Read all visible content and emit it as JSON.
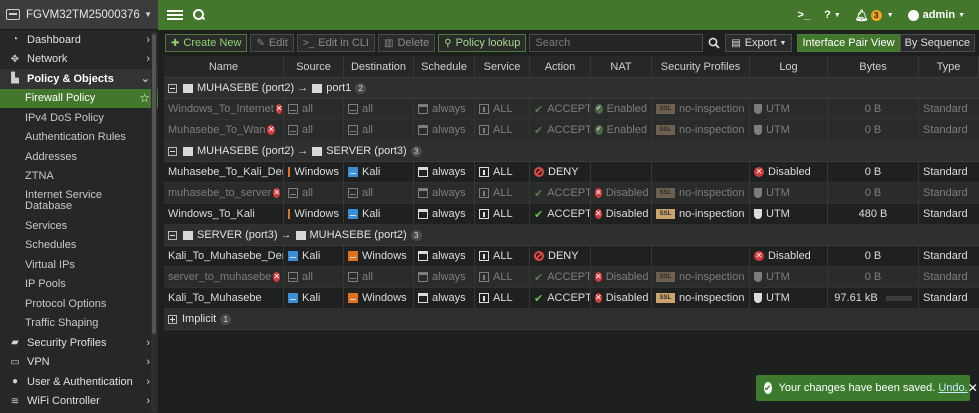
{
  "device": {
    "name": "FGVM32TM25000376"
  },
  "topbar": {
    "cli_icon": ">_",
    "help_icon": "?",
    "alert_count": "3",
    "user": "admin"
  },
  "sidebar": {
    "items": [
      {
        "label": "Dashboard",
        "icon": "dashboard-icon",
        "glyph": "◔"
      },
      {
        "label": "Network",
        "icon": "network-icon",
        "glyph": "✥"
      },
      {
        "label": "Policy & Objects",
        "icon": "policy-objects-icon",
        "glyph": "▙"
      }
    ],
    "sub_items": [
      {
        "label": "Firewall Policy"
      },
      {
        "label": "IPv4 DoS Policy"
      },
      {
        "label": "Authentication Rules"
      },
      {
        "label": "Addresses"
      },
      {
        "label": "ZTNA"
      },
      {
        "label": "Internet Service Database"
      },
      {
        "label": "Services"
      },
      {
        "label": "Schedules"
      },
      {
        "label": "Virtual IPs"
      },
      {
        "label": "IP Pools"
      },
      {
        "label": "Protocol Options"
      },
      {
        "label": "Traffic Shaping"
      }
    ],
    "bottom_items": [
      {
        "label": "Security Profiles",
        "icon": "lock-icon",
        "glyph": "▰"
      },
      {
        "label": "VPN",
        "icon": "monitor-icon",
        "glyph": "▭"
      },
      {
        "label": "User & Authentication",
        "icon": "user-icon",
        "glyph": "●"
      },
      {
        "label": "WiFi Controller",
        "icon": "wifi-icon",
        "glyph": "≋"
      }
    ]
  },
  "toolbar": {
    "create_new": "Create New",
    "edit": "Edit",
    "edit_cli": "Edit in CLI",
    "delete": "Delete",
    "policy_lookup": "Policy lookup",
    "search_placeholder": "Search",
    "export": "Export",
    "interface_pair_view": "Interface Pair View",
    "by_sequence": "By Sequence"
  },
  "table": {
    "columns": [
      "Name",
      "Source",
      "Destination",
      "Schedule",
      "Service",
      "Action",
      "NAT",
      "Security Profiles",
      "Log",
      "Bytes",
      "Type"
    ],
    "groups": [
      {
        "src": "MUHASEBE (port2)",
        "dst": "port1",
        "count": "2",
        "rows": [
          {
            "name": "Windows_To_Internet",
            "disabled": true,
            "source": "all",
            "src_type": "plain",
            "destination": "all",
            "dst_type": "plain",
            "schedule": "always",
            "service": "ALL",
            "action": "ACCEPT",
            "nat": "Enabled",
            "profile_ssl": "SSL",
            "profile": "no-inspection",
            "log": "UTM",
            "bytes": "0 B",
            "bar": false,
            "type": "Standard"
          },
          {
            "name": "Muhasebe_To_Wan",
            "disabled": true,
            "source": "all",
            "src_type": "plain",
            "destination": "all",
            "dst_type": "plain",
            "schedule": "always",
            "service": "ALL",
            "action": "ACCEPT",
            "nat": "Enabled",
            "profile_ssl": "SSL",
            "profile": "no-inspection",
            "log": "UTM",
            "bytes": "0 B",
            "bar": false,
            "type": "Standard"
          }
        ]
      },
      {
        "src": "MUHASEBE (port2)",
        "dst": "SERVER (port3)",
        "count": "3",
        "rows": [
          {
            "name": "Muhasebe_To_Kali_Deny",
            "disabled": false,
            "source": "Windows",
            "src_type": "orange",
            "destination": "Kali",
            "dst_type": "blue",
            "schedule": "always",
            "service": "ALL",
            "action": "DENY",
            "nat": "",
            "profile_ssl": "",
            "profile": "",
            "log": "Disabled",
            "bytes": "0 B",
            "bar": false,
            "type": "Standard"
          },
          {
            "name": "muhasebe_to_server",
            "disabled": true,
            "source": "all",
            "src_type": "plain",
            "destination": "all",
            "dst_type": "plain",
            "schedule": "always",
            "service": "ALL",
            "action": "ACCEPT",
            "nat": "Disabled",
            "profile_ssl": "SSL",
            "profile": "no-inspection",
            "log": "UTM",
            "bytes": "0 B",
            "bar": false,
            "type": "Standard"
          },
          {
            "name": "Windows_To_Kali",
            "disabled": false,
            "source": "Windows",
            "src_type": "orange",
            "destination": "Kali",
            "dst_type": "blue",
            "schedule": "always",
            "service": "ALL",
            "action": "ACCEPT",
            "nat": "Disabled",
            "profile_ssl": "SSL",
            "profile": "no-inspection",
            "log": "UTM",
            "bytes": "480 B",
            "bar": false,
            "type": "Standard"
          }
        ]
      },
      {
        "src": "SERVER (port3)",
        "dst": "MUHASEBE (port2)",
        "count": "3",
        "rows": [
          {
            "name": "Kali_To_Muhasebe_Deny",
            "disabled": false,
            "source": "Kali",
            "src_type": "blue",
            "destination": "Windows",
            "dst_type": "orange",
            "schedule": "always",
            "service": "ALL",
            "action": "DENY",
            "nat": "",
            "profile_ssl": "",
            "profile": "",
            "log": "Disabled",
            "bytes": "0 B",
            "bar": false,
            "type": "Standard"
          },
          {
            "name": "server_to_muhasebe",
            "disabled": true,
            "source": "all",
            "src_type": "plain",
            "destination": "all",
            "dst_type": "plain",
            "schedule": "always",
            "service": "ALL",
            "action": "ACCEPT",
            "nat": "Disabled",
            "profile_ssl": "SSL",
            "profile": "no-inspection",
            "log": "UTM",
            "bytes": "0 B",
            "bar": false,
            "type": "Standard"
          },
          {
            "name": "Kali_To_Muhasebe",
            "disabled": false,
            "source": "Kali",
            "src_type": "blue",
            "destination": "Windows",
            "dst_type": "orange",
            "schedule": "always",
            "service": "ALL",
            "action": "ACCEPT",
            "nat": "Disabled",
            "profile_ssl": "SSL",
            "profile": "no-inspection",
            "log": "UTM",
            "bytes": "97.61 kB",
            "bar": true,
            "type": "Standard"
          }
        ]
      }
    ],
    "implicit": {
      "label": "Implicit",
      "count": "1"
    }
  },
  "toast": {
    "message": "Your changes have been saved.",
    "undo": "Undo.",
    "close": "✕"
  },
  "colors": {
    "accent": "#43772c",
    "deny": "#e04848",
    "disabled_log": "#d43c3c",
    "toast": "#3c7a2e"
  }
}
